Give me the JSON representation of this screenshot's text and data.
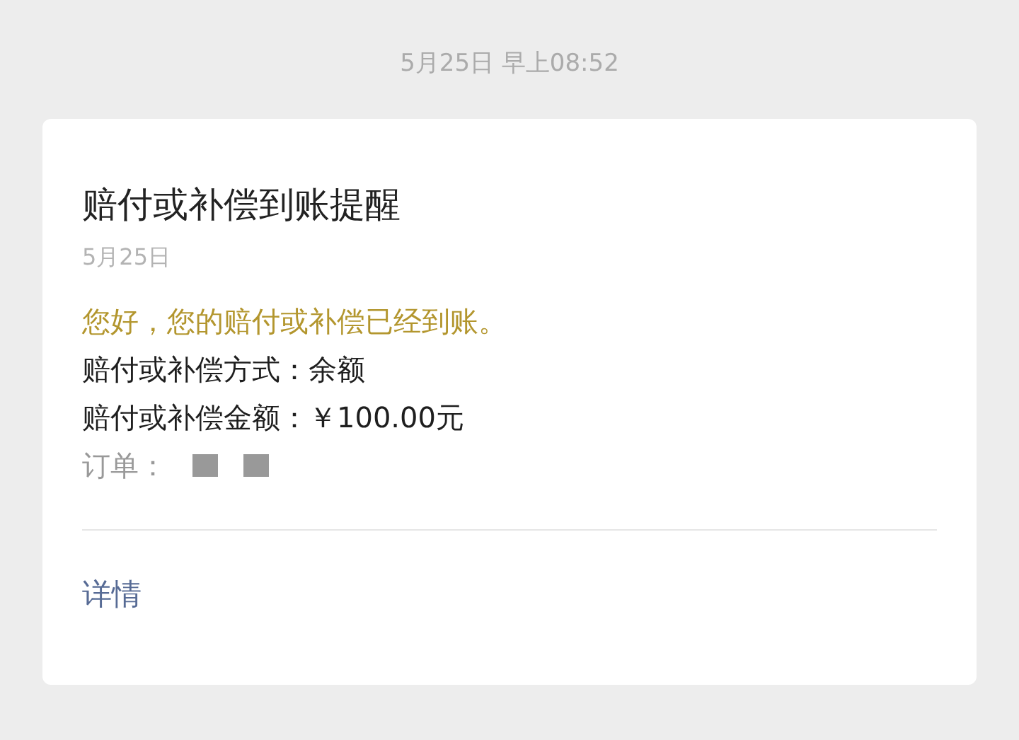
{
  "timestamp": "5月25日 早上08:52",
  "card": {
    "title": "赔付或补偿到账提醒",
    "date": "5月25日",
    "lines": [
      {
        "kind": "greeting",
        "text": "您好，您的赔付或补偿已经到账。"
      },
      {
        "kind": "field",
        "text": "赔付或补偿方式：余额"
      },
      {
        "kind": "field",
        "text": "赔付或补偿金额：￥100.00元"
      },
      {
        "kind": "redacted",
        "text": "订单："
      }
    ],
    "link": "详情"
  }
}
